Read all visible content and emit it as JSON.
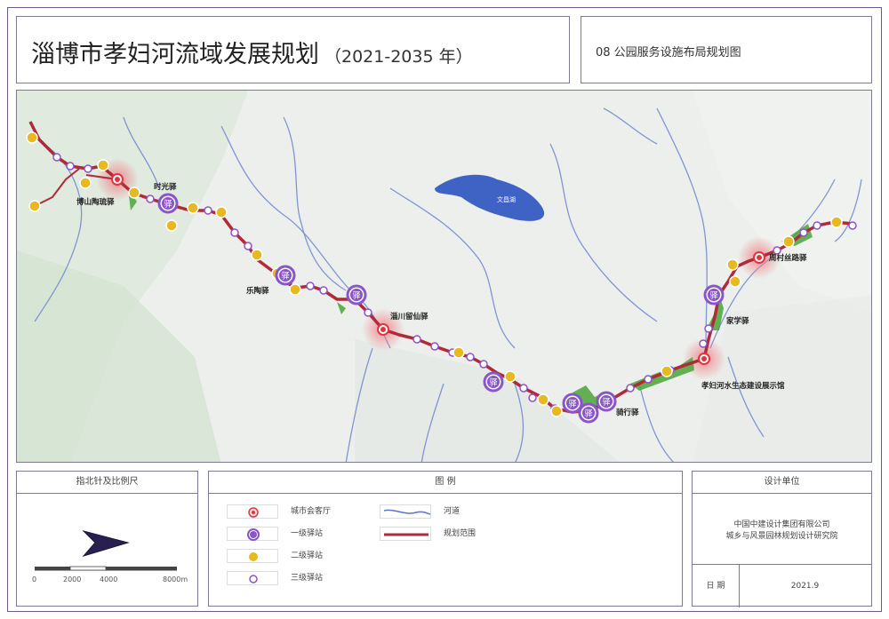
{
  "title": {
    "main": "淄博市孝妇河流域发展规划",
    "years": "（2021-2035 年）"
  },
  "subtitle": "08 公园服务设施布局规划图",
  "map": {
    "lake_label": "文昌湖",
    "stations": [
      {
        "label": "博山陶琉驿",
        "type": "city"
      },
      {
        "label": "时光驿",
        "type": "level1"
      },
      {
        "label": "乐陶驿",
        "type": "level1"
      },
      {
        "label": "淄川留仙驿",
        "type": "city"
      },
      {
        "label": "骑行驿",
        "type": "level1"
      },
      {
        "label": "孝妇河水生态建设展示馆",
        "type": "city"
      },
      {
        "label": "家学驿",
        "type": "level1"
      },
      {
        "label": "周村丝路驿",
        "type": "city"
      }
    ],
    "station_glyph": "驿",
    "colors": {
      "route": "#b02a3a",
      "river": "#5a74c8",
      "lake": "#3f63c4",
      "level1_ring": "#8a55c8",
      "level2_fill": "#e8b820",
      "city_dot": "#e0343f",
      "green_belt": "#4aa43a"
    }
  },
  "compass_panel": {
    "heading": "指北针及比例尺",
    "north_icon": "north-arrow-icon",
    "scale_labels": [
      "0",
      "2000",
      "4000",
      "8000m"
    ]
  },
  "legend": {
    "heading": "图 例",
    "items": [
      {
        "label": "城市会客厅",
        "icon": "city-parlor-icon"
      },
      {
        "label": "一级驿站",
        "icon": "level1-station-icon"
      },
      {
        "label": "二级驿站",
        "icon": "level2-station-icon"
      },
      {
        "label": "三级驿站",
        "icon": "level3-station-icon"
      },
      {
        "label": "河道",
        "icon": "river-line-icon"
      },
      {
        "label": "规划范围",
        "icon": "planning-boundary-icon"
      }
    ]
  },
  "design_unit": {
    "heading": "设计单位",
    "org_line1": "中国中建设计集团有限公司",
    "org_line2": "城乡与风景园林规划设计研究院",
    "date_label": "日 期",
    "date_value": "2021.9"
  }
}
